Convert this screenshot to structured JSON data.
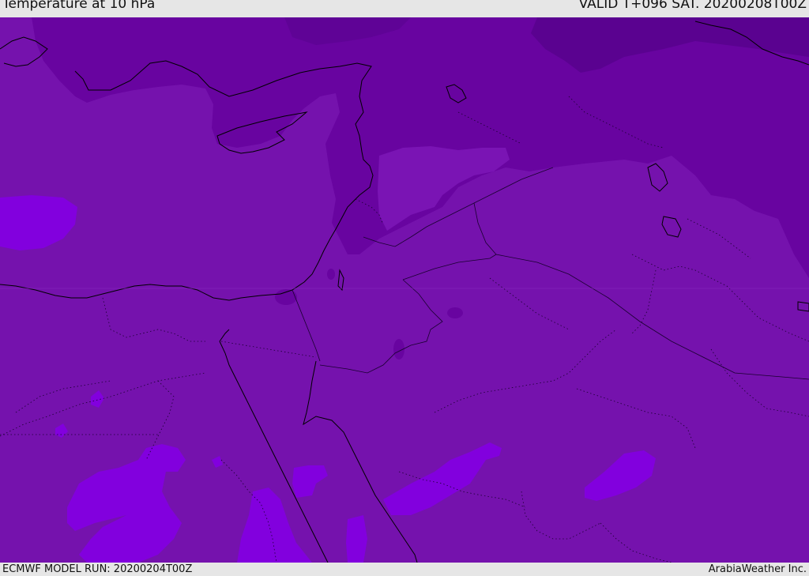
{
  "header": {
    "title": "Temperature at 10 hPa",
    "valid": "VALID T+096 SAT. 20200208T00Z"
  },
  "footer": {
    "model_run": "ECMWF MODEL RUN: 20200204T00Z",
    "brand": "ArabiaWeather Inc."
  },
  "map": {
    "region": "Eastern Mediterranean / Middle East",
    "colors": {
      "base": "#7512ad",
      "darker": "#6804a0",
      "darkest": "#5a0290",
      "lighter": "#8200de",
      "coastline": "#000000",
      "border": "#1a0030"
    }
  }
}
